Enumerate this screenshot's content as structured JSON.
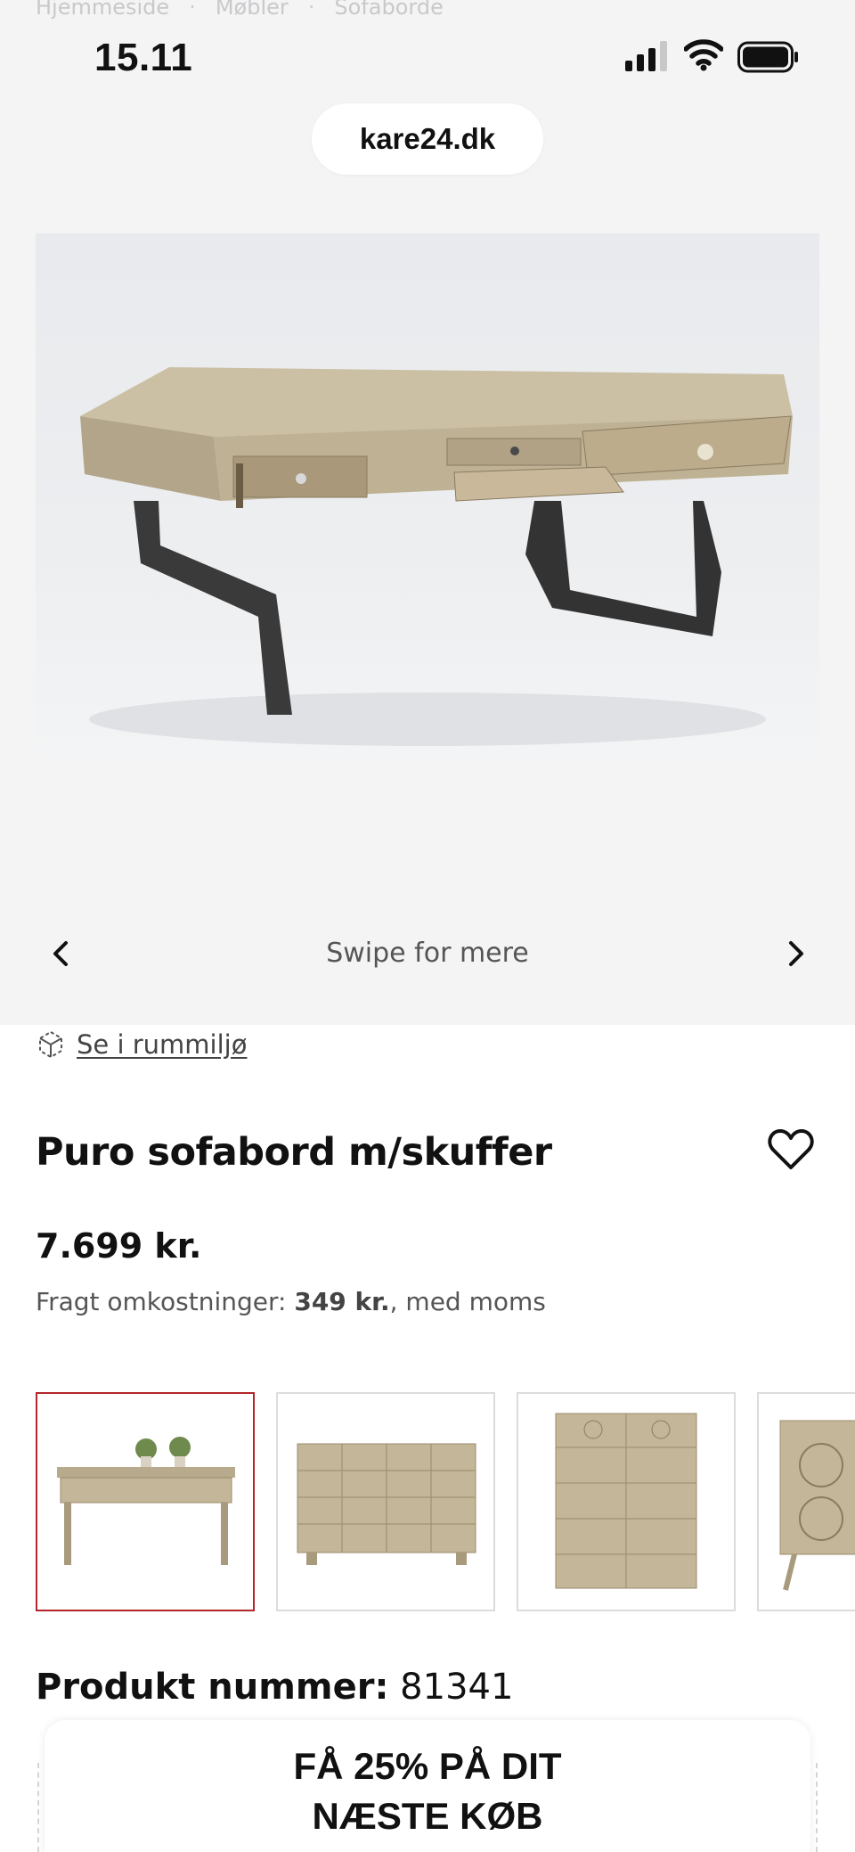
{
  "breadcrumb": [
    "Hjemmeside",
    "Møbler",
    "Sofaborde"
  ],
  "status": {
    "time": "15.11"
  },
  "browser": {
    "url": "kare24.dk"
  },
  "gallery": {
    "swipe_text": "Swipe for mere"
  },
  "room_link": "Se i rummiljø",
  "product": {
    "title": "Puro sofabord m/skuffer",
    "price": "7.699 kr.",
    "shipping_label": "Fragt omkostninger:",
    "shipping_value": "349 kr.",
    "shipping_suffix": ", med moms",
    "number_label": "Produkt nummer:",
    "number_value": "81341"
  },
  "related": [
    {
      "name": "desk-with-plants"
    },
    {
      "name": "chest-of-drawers-wide"
    },
    {
      "name": "chest-of-drawers-tall"
    },
    {
      "name": "cabinet-carved"
    }
  ],
  "promo": {
    "line1": "FÅ 25% PÅ DIT",
    "line2": "NÆSTE KØB"
  },
  "colors": {
    "accent": "#b4262b",
    "background": "#f4f4f5"
  }
}
